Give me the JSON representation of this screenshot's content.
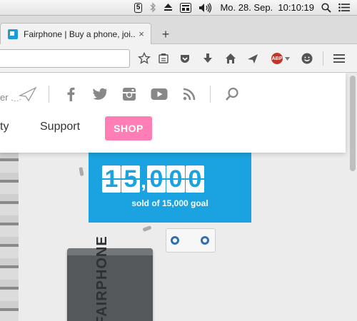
{
  "menubar": {
    "icons": [
      "notification-5-icon",
      "bluetooth-icon",
      "eject-icon",
      "keyboard-icon",
      "volume-icon"
    ],
    "badge": "5",
    "clock": "Mo. 28. Sep.  10:10:19"
  },
  "browser": {
    "tab_title": "Fairphone | Buy a phone, joi...",
    "tab_close": "×",
    "new_tab": "+",
    "url_value": "",
    "abp_label": "ABP"
  },
  "site": {
    "share_text": "er",
    "social_icons": [
      "facebook-icon",
      "twitter-icon",
      "instagram-icon",
      "youtube-icon",
      "rss-icon"
    ],
    "nav": {
      "community_partial": "ty",
      "support": "Support",
      "shop": "SHOP"
    },
    "counter": {
      "digits": [
        "1",
        "5",
        "0",
        "0",
        "0"
      ],
      "comma": ",",
      "caption": "sold of 15,000 goal"
    },
    "battery_text": "FAIRPHONE"
  },
  "colors": {
    "shop_pink": "#ff7eb6",
    "counter_blue": "#1aa3e0",
    "abp_red": "#c2352c"
  }
}
